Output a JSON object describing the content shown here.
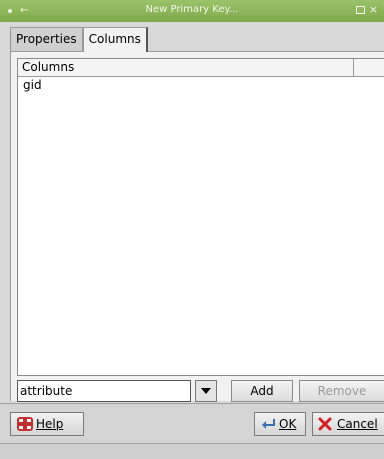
{
  "window": {
    "title": "New Primary Key..."
  },
  "tabs": [
    {
      "label": "Properties",
      "active": false
    },
    {
      "label": "Columns",
      "active": true
    }
  ],
  "columns_list": {
    "header": "Columns",
    "rows": [
      "gid"
    ]
  },
  "controls": {
    "combo_value": "attribute",
    "add_label": "Add",
    "remove_label": "Remove"
  },
  "buttons": {
    "help_label": "Help",
    "ok_label": "OK",
    "cancel_label": "Cancel"
  },
  "icons": {
    "window_menu": "window-menu-icon",
    "back": "back-arrow-icon",
    "maximize": "maximize-icon",
    "close": "close-icon",
    "dropdown": "chevron-down-icon",
    "help": "lifebuoy-icon",
    "ok": "ok-arrow-icon",
    "cancel": "red-x-icon"
  },
  "colors": {
    "titlebar": "#8ab35a",
    "panel": "#f2f2f2",
    "dialog": "#d4d4d4"
  }
}
